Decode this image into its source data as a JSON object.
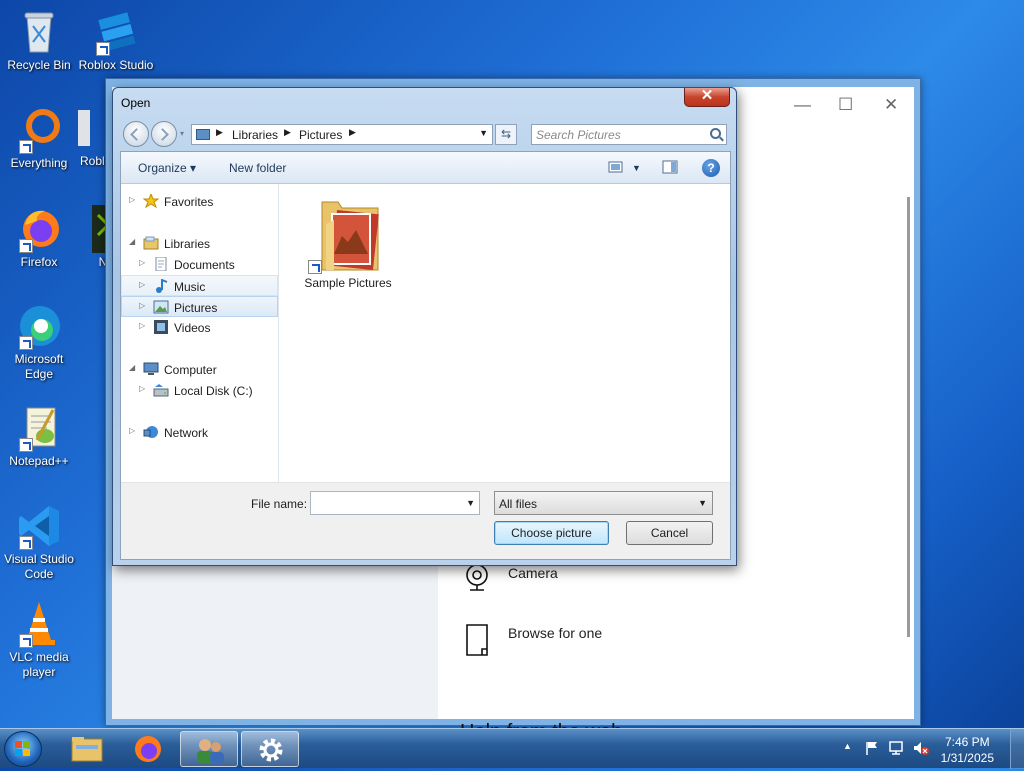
{
  "desktop": {
    "icons": [
      {
        "label": "Recycle Bin"
      },
      {
        "label": "Roblox Studio"
      },
      {
        "label": "Everything"
      },
      {
        "label": "Robl"
      },
      {
        "label": "Firefox"
      },
      {
        "label": "N"
      },
      {
        "label": "Microsoft Edge"
      },
      {
        "label": "Notepad++"
      },
      {
        "label": "Visual Studio Code"
      },
      {
        "label": "VLC media player"
      }
    ]
  },
  "background_window": {
    "options": [
      {
        "label": "Camera",
        "icon": "camera-icon"
      },
      {
        "label": "Browse for one",
        "icon": "file-icon"
      }
    ],
    "partial_heading": "Help from the web"
  },
  "dialog": {
    "title": "Open",
    "close_label": "✕",
    "address": {
      "crumbs": [
        "Libraries",
        "Pictures"
      ]
    },
    "search_placeholder": "Search Pictures",
    "toolbar": {
      "organize_label": "Organize ▾",
      "new_folder_label": "New folder",
      "help_label": "?"
    },
    "nav": [
      {
        "label": "Favorites",
        "icon": "star-icon"
      },
      {
        "label": "Libraries",
        "icon": "libraries-icon"
      },
      {
        "label": "Documents",
        "icon": "documents-icon"
      },
      {
        "label": "Music",
        "icon": "music-icon"
      },
      {
        "label": "Pictures",
        "icon": "pictures-icon"
      },
      {
        "label": "Videos",
        "icon": "videos-icon"
      },
      {
        "label": "Computer",
        "icon": "computer-icon"
      },
      {
        "label": "Local Disk (C:)",
        "icon": "disk-icon"
      },
      {
        "label": "Network",
        "icon": "network-icon"
      }
    ],
    "files": [
      {
        "label": "Sample Pictures",
        "icon": "folder-icon"
      }
    ],
    "file_name_label": "File name:",
    "file_name_value": "",
    "filter_value": "All files",
    "choose_button": "Choose picture",
    "cancel_button": "Cancel"
  },
  "taskbar": {
    "time": "7:46 PM",
    "date": "1/31/2025"
  }
}
